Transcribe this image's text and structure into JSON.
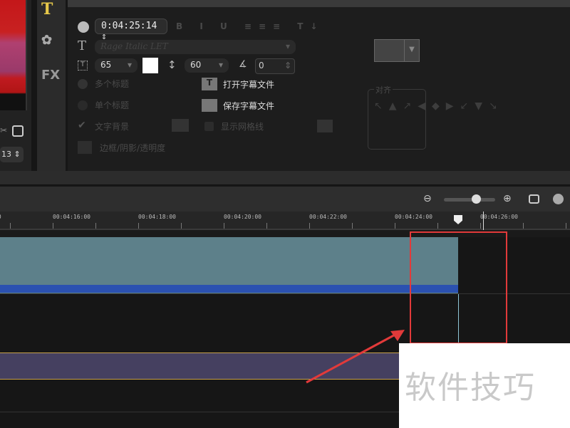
{
  "preview": {
    "spin_value": "13"
  },
  "sidetabs": {
    "title_tab": "T",
    "fx_tab": "FX"
  },
  "options": {
    "timecode": "0:04:25:14",
    "font_name": "Rage Italic LET",
    "font_size": "65",
    "line_spacing": "60",
    "angle": "0",
    "multi_title": "多个标题",
    "single_title": "单个标题",
    "text_bg": "文字背景",
    "show_grid": "显示网格线",
    "border_shadow": "边框/阴影/透明度",
    "open_subtitle": "打开字幕文件",
    "save_subtitle": "保存字幕文件",
    "align_label": "对齐"
  },
  "ruler": {
    "labels": [
      "00:04:16:00",
      "00:04:18:00",
      "00:04:20:00",
      "00:04:22:00",
      "00:04:24:00",
      "00:04:26:00"
    ]
  },
  "watermark": "软件技巧",
  "colors": {
    "clip": "#5d808a",
    "audio": "#454060",
    "highlight": "#e23a3a"
  }
}
